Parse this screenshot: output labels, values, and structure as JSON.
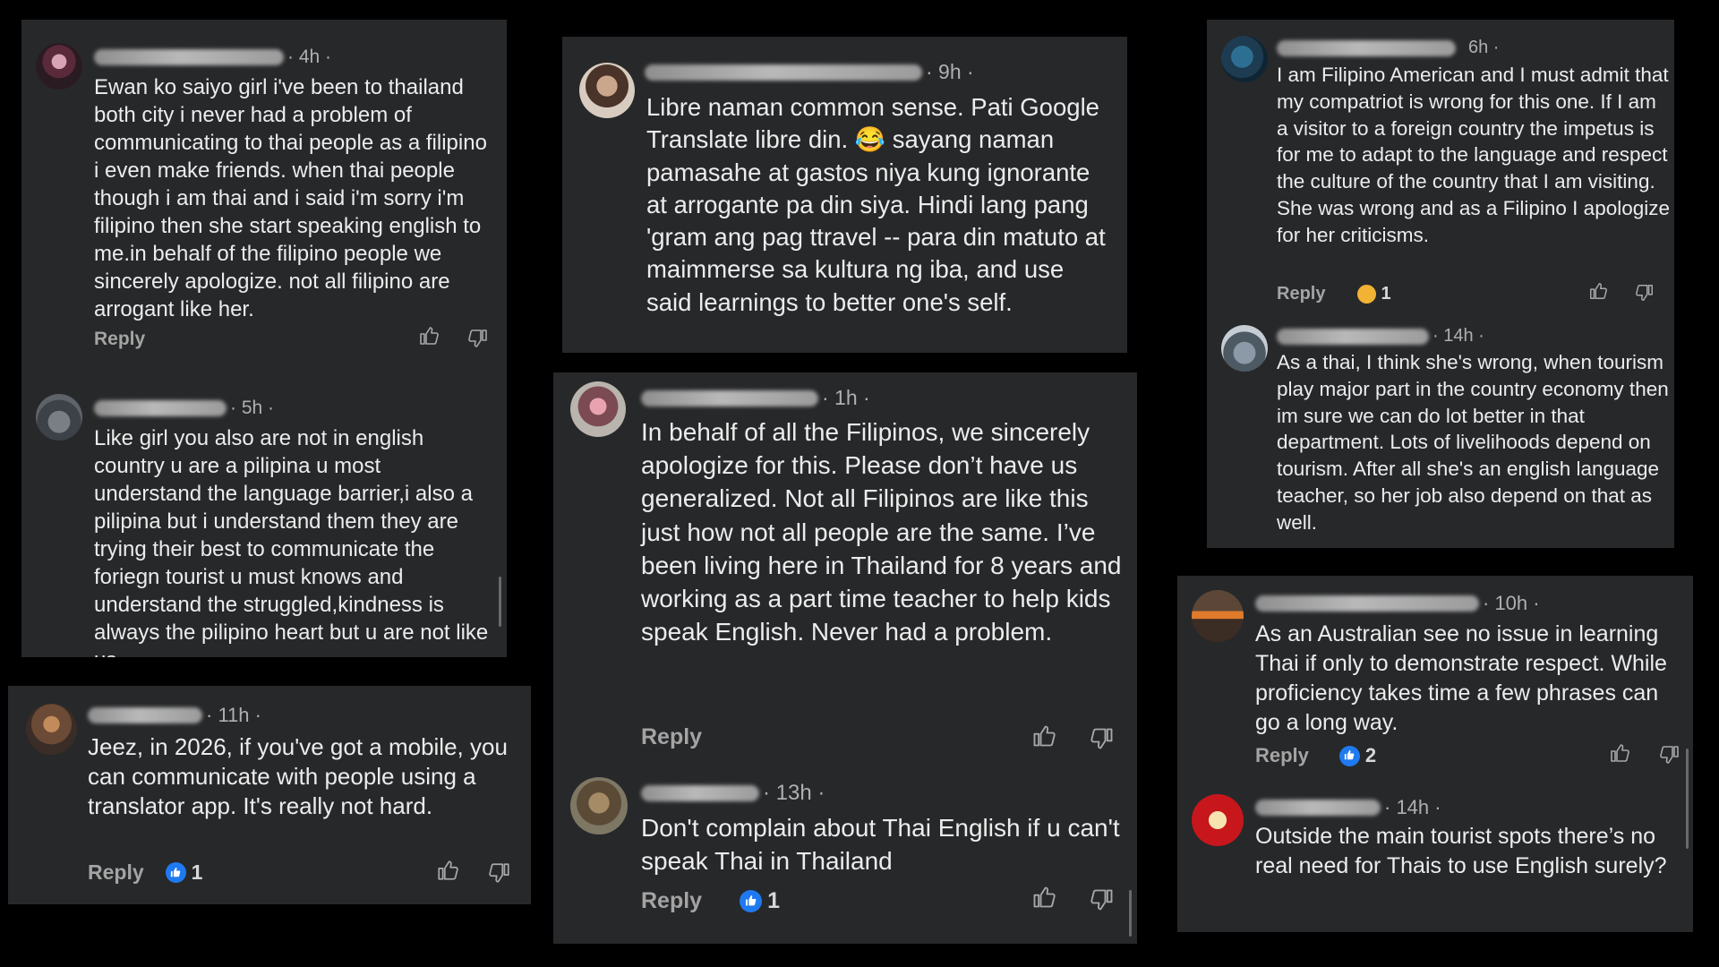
{
  "colors": {
    "background": "#000000",
    "panel": "#27282a",
    "text": "#ececec",
    "muted": "#a4a4a4",
    "like_blue": "#1f7af0"
  },
  "icons": {
    "like": "thumbs-up-icon",
    "dislike": "thumbs-down-icon",
    "reaction_like": "like-reaction-icon",
    "reaction_haha": "haha-reaction-icon"
  },
  "p1": {
    "c1": {
      "time": "· 4h ·",
      "text": "Ewan ko saiyo girl i've been to thailand both city i never had a problem of communicating to thai people as a filipino  i even make friends. when thai people though i am thai and i said i'm sorry i'm filipino then she start speaking english to me.in behalf of the filipino people we sincerely apologize. not all  filipino are arrogant like her.",
      "reply": "Reply"
    },
    "c2": {
      "time": "· 5h ·",
      "text": "Like girl you also are not in english country u are a pilipina u most understand the language barrier,i also a pilipina but i understand them they are trying their best to communicate the foriegn tourist u must knows and understand the struggled,kindness is always the pilipino heart but u are not like us."
    }
  },
  "p2": {
    "c1": {
      "time": "· 11h ·",
      "text": "Jeez, in 2026, if you've got a mobile, you can communicate with people using a translator app. It's really not hard.",
      "reply": "Reply",
      "reactions": "1"
    }
  },
  "p3": {
    "c1": {
      "time": "· 9h ·",
      "text": "Libre naman common sense. Pati Google Translate libre din. 😂 sayang naman pamasahe at gastos niya kung ignorante at arrogante pa din siya. Hindi lang pang 'gram ang pag ttravel -- para din matuto at maimmerse sa kultura ng iba, and use said learnings to better one's self."
    }
  },
  "p4": {
    "c1": {
      "time": "· 1h ·",
      "text": "In behalf of all the Filipinos, we sincerely apologize for this. Please don’t have us generalized. Not all Filipinos are like this just how not all people are the same. I’ve been living here in Thailand for 8 years and working as a part time teacher to help kids speak English. Never had a problem.",
      "reply": "Reply"
    },
    "c2": {
      "time": "· 13h ·",
      "text": "Don't complain about Thai English if u can't speak Thai in Thailand",
      "reply": "Reply",
      "reactions": "1"
    }
  },
  "p5": {
    "c1": {
      "time": "6h ·",
      "text": "I am Filipino American and I must admit that my compatriot is wrong for this one. If I am a visitor to a foreign country the impetus is for me to adapt to the language and respect the culture of the country that I am visiting. She was wrong and as a Filipino I apologize for her criticisms.",
      "reply": "Reply",
      "reactions": "1"
    },
    "c2": {
      "time": "· 14h ·",
      "text": "As a thai, I think she's wrong, when tourism play major part in the country economy then im sure we can do lot better in that department.  Lots of livelihoods depend on tourism. After all she's an english language teacher, so her job also depend on that as well."
    }
  },
  "p6": {
    "c1": {
      "time": "· 10h ·",
      "text": "As an Australian see no issue in learning Thai if only to demonstrate respect. While proficiency takes time a few phrases can go a long way.",
      "reply": "Reply",
      "reactions": "2"
    },
    "c2": {
      "time": "· 14h ·",
      "text": "Outside the main tourist spots there’s no real need for Thais to use English surely?"
    }
  }
}
